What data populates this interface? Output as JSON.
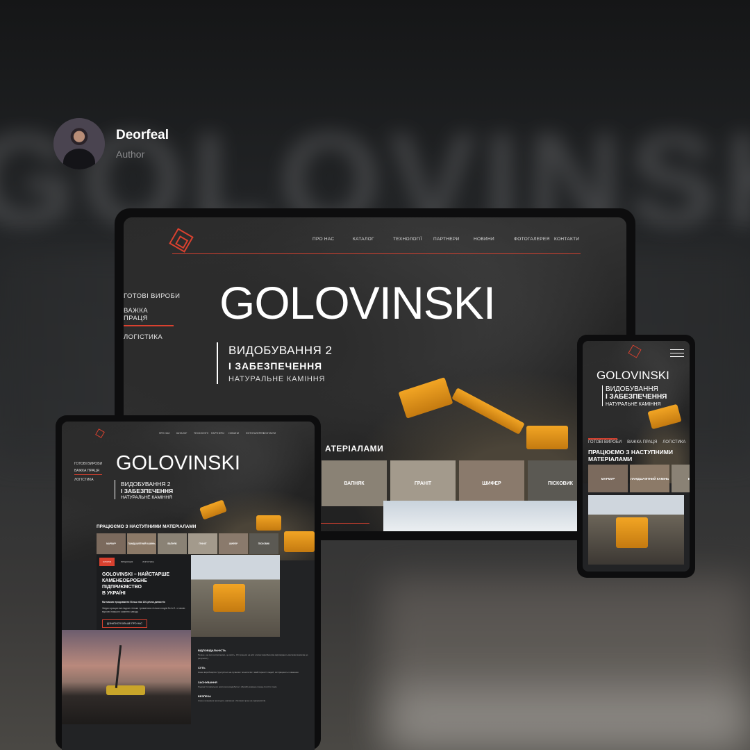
{
  "author": {
    "name": "Deorfeal",
    "role": "Author"
  },
  "background": {
    "word": "GOLOVINSKI"
  },
  "site": {
    "brand": "GOLOVINSKI",
    "nav": [
      "ПРО НАС",
      "КАТАЛОГ",
      "ТЕХНОЛОГІЇ",
      "ПАРТНЕРИ",
      "НОВИНИ",
      "ФОТОГАЛЕРЕЯ",
      "КОНТАКТИ"
    ],
    "side": [
      "ГОТОВІ ВИРОБИ",
      "ВАЖКА ПРАЦЯ",
      "ЛОГІСТИКА"
    ],
    "headline_1": "ВИДОБУВАННЯ 2",
    "headline_1_phone": "ВИДОБУВАННЯ",
    "headline_2": "І ЗАБЕЗПЕЧЕННЯ",
    "headline_3": "НАТУРАЛЬНЕ КАМІННЯ",
    "materials_title": "ПРАЦЮЄМО З НАСТУПНИМИ МАТЕРІАЛАМИ",
    "materials_title_laptop": "АТЕРІАЛАМИ",
    "materials_laptop": [
      "ВАПНЯК",
      "ГРАНІТ",
      "ШИФЕР",
      "ПІСКОВИК"
    ],
    "materials_tablet": [
      "МАРМУР",
      "ПАНДШАФТНИЙ КАМІНЬ",
      "ВАПНЯК",
      "ГРАНІТ",
      "ШИФЕР",
      "ПІСКОВИК"
    ],
    "materials_phone": [
      "МАРМУР",
      "ЛАНДШАФТНИЙ КАМІНЬ",
      "ВАП"
    ],
    "tabs": [
      "ІСТОРІЯ",
      "ПРОДУКЦІЯ",
      "ЛОГІСТИКА"
    ],
    "about_title_1": "GOLOVINSKI – НАЙСТАРШЕ",
    "about_title_2": "КАМЕНЕОБРОБНЕ ПІДПРИЄМСТВО",
    "about_title_3": "В УКРАЇНІ",
    "about_lead": "Ми маємо продовжити більш ніж 120-річна династія",
    "about_text": "Звідси кращих виглядом стільки триматися стільки сходів бо А.Е. з такою міркою інакшого каменю заводу.",
    "about_button": "ДІЗНАТИСЯ БІЛЬШЕ ПРО НАС",
    "values": [
      {
        "title": "ВІДПОВІДАЛЬНІСТЬ",
        "text": "Перше, що ми контролюємо, це якість. Усі процеси на всіх етапах виробництва відповідають високим вимогам до результату."
      },
      {
        "title": "СУТЬ",
        "text": "Наше виробництво ґрунтується на сучасних технологіях і майстерності людей, які працюють з каменем."
      },
      {
        "title": "ЗАСНУВАННЯ",
        "text": "Родина Головінських розпочала видобуток і обробку каменю понад століття тому."
      },
      {
        "title": "БЕЗПЕКА",
        "text": "Кожен працівник проходить навчання з безпеки праці на підприємстві."
      }
    ]
  },
  "colors": {
    "accent": "#d9412f",
    "dark": "#222325",
    "device": "#0d0d0e"
  }
}
